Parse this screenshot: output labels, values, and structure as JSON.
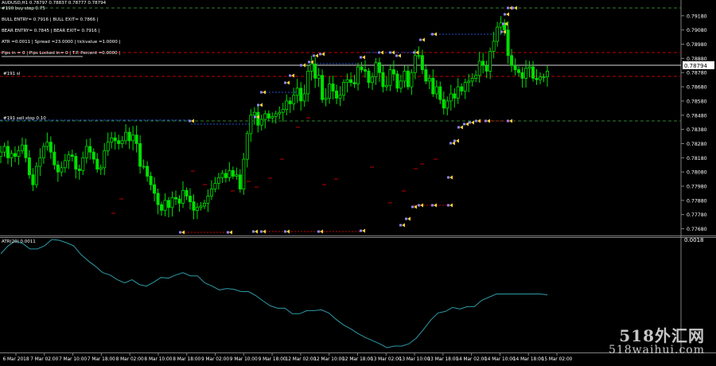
{
  "header": {
    "symbol": "AUDUSD,H1  0.78797 0.78837 0.78777 0.78794",
    "buy_stop_label": "#190 buy stop 0.75",
    "bull_line": "BULL ENTRY= 0.7916 | BULL EXIT= 0.7866 |",
    "bear_line": "BEAR ENTRY= 0.7845 | BEAR EXIT= 0.7916 |",
    "atr_line": "ATR =0.0011 | Spread =23.0000 | tickvalue =1.0000 |",
    "pips_line": "Pips in = 0 | Pips Locked in= 0 | T.P. Percent =0.0000 |",
    "sl_label": "#191 sl",
    "sell_stop_label": "#191 sell stop 0.10"
  },
  "indicator": {
    "label": "ATR(20) 0.0011",
    "axis_value": "0.0018"
  },
  "watermark": {
    "line1": "518外汇网",
    "line2": "518waihui.com"
  },
  "colors": {
    "up": "#00e000",
    "down": "#00e000",
    "background": "#000000",
    "atr": "#2e9aa6",
    "sl_line": "#c00000",
    "level_line": "#2f7f2f",
    "stop_line": "#1e50c8",
    "arrow": "#ffd23c"
  },
  "chart_data": [
    {
      "type": "candlestick",
      "title": "AUDUSD,H1",
      "y_ticks": [
        "0.79180",
        "0.79080",
        "0.78980",
        "0.78880",
        "0.78780",
        "0.78680",
        "0.78580",
        "0.78480",
        "0.78380",
        "0.78280",
        "0.78180",
        "0.78080",
        "0.77980",
        "0.77880",
        "0.77780",
        "0.77680"
      ],
      "ylim": [
        0.77655,
        0.79235
      ],
      "current_price": "0.78794",
      "x_ticks": [
        "6 Mar 2018",
        "7 Mar 02:00",
        "7 Mar 10:00",
        "7 Mar 18:00",
        "8 Mar 02:00",
        "8 Mar 10:00",
        "8 Mar 18:00",
        "9 Mar 02:00",
        "9 Mar 10:00",
        "9 Mar 18:00",
        "12 Mar 02:00",
        "12 Mar 10:00",
        "12 Mar 18:00",
        "13 Mar 02:00",
        "13 Mar 10:00",
        "13 Mar 18:00",
        "14 Mar 02:00",
        "14 Mar 10:00",
        "14 Mar 18:00",
        "15 Mar 02:00"
      ],
      "close": [
        0.7822,
        0.7826,
        0.7818,
        0.7821,
        0.7819,
        0.7823,
        0.7827,
        0.7818,
        0.7806,
        0.7799,
        0.7812,
        0.7818,
        0.7826,
        0.7829,
        0.7822,
        0.7813,
        0.7808,
        0.7811,
        0.7816,
        0.782,
        0.7819,
        0.781,
        0.7809,
        0.7818,
        0.7826,
        0.7822,
        0.7817,
        0.781,
        0.7811,
        0.7823,
        0.7829,
        0.7832,
        0.783,
        0.7828,
        0.783,
        0.7836,
        0.783,
        0.7834,
        0.7828,
        0.7812,
        0.7812,
        0.7805,
        0.7799,
        0.7793,
        0.7785,
        0.7781,
        0.7788,
        0.7783,
        0.779,
        0.7789,
        0.7786,
        0.7795,
        0.7791,
        0.7787,
        0.7781,
        0.7783,
        0.7784,
        0.7786,
        0.7791,
        0.7796,
        0.78,
        0.7804,
        0.7807,
        0.7804,
        0.7809,
        0.7805,
        0.7806,
        0.7796,
        0.7817,
        0.7835,
        0.7848,
        0.785,
        0.7841,
        0.7845,
        0.7849,
        0.7846,
        0.7847,
        0.7849,
        0.785,
        0.7852,
        0.7858,
        0.7856,
        0.7862,
        0.7867,
        0.7858,
        0.7863,
        0.7879,
        0.7884,
        0.7874,
        0.7876,
        0.7859,
        0.786,
        0.787,
        0.7865,
        0.786,
        0.7862,
        0.7871,
        0.7873,
        0.7871,
        0.787,
        0.7882,
        0.788,
        0.7879,
        0.7871,
        0.7875,
        0.7885,
        0.7878,
        0.7868,
        0.7869,
        0.788,
        0.7877,
        0.7867,
        0.7872,
        0.7879,
        0.7868,
        0.7878,
        0.789,
        0.789,
        0.788,
        0.7872,
        0.7874,
        0.7863,
        0.7868,
        0.7859,
        0.7853,
        0.7858,
        0.7863,
        0.786,
        0.7868,
        0.7865,
        0.7871,
        0.7872,
        0.7874,
        0.7876,
        0.7886,
        0.7883,
        0.7879,
        0.7893,
        0.79,
        0.791,
        0.7913,
        0.7908,
        0.789,
        0.7883,
        0.788,
        0.7878,
        0.7874,
        0.7881,
        0.7882,
        0.7874,
        0.7873,
        0.7875,
        0.7875,
        0.7879
      ],
      "series": [
        {
          "name": "ATR(20)",
          "values": [
            0.00162,
            0.00172,
            0.00178,
            0.00175,
            0.00168,
            0.00168,
            0.00172,
            0.0018,
            0.00179,
            0.00176,
            0.00172,
            0.00161,
            0.00153,
            0.00146,
            0.00138,
            0.00135,
            0.00129,
            0.00125,
            0.00129,
            0.00123,
            0.00121,
            0.00126,
            0.00132,
            0.00131,
            0.00135,
            0.00138,
            0.00134,
            0.00134,
            0.00125,
            0.00121,
            0.00116,
            0.00118,
            0.00117,
            0.00114,
            0.00114,
            0.00109,
            0.00102,
            0.00096,
            0.00093,
            0.00093,
            0.00086,
            0.00086,
            0.0009,
            0.0009,
            0.00091,
            0.00087,
            0.00079,
            0.00072,
            0.00067,
            0.00061,
            0.00056,
            0.00052,
            0.00048,
            0.00043,
            0.00045,
            0.00045,
            0.00048,
            0.00055,
            0.00066,
            0.00078,
            0.00087,
            0.00089,
            0.00094,
            0.00092,
            0.00095,
            0.00095,
            0.00103,
            0.00107,
            0.00111,
            0.00111,
            0.00111,
            0.00111,
            0.00111,
            0.00111,
            0.00111,
            0.0011
          ]
        }
      ]
    }
  ]
}
